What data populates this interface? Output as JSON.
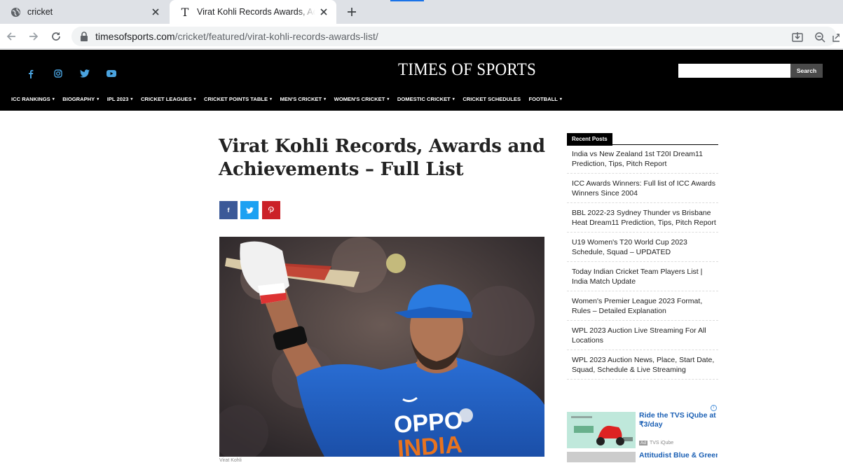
{
  "browser": {
    "tabs": [
      {
        "title": "cricket",
        "active": false
      },
      {
        "title": "Virat Kohli Records Awards, Achie",
        "active": true
      }
    ],
    "url_host": "timesofsports.com",
    "url_path": "/cricket/featured/virat-kohli-records-awards-list/",
    "icons": [
      "globe-icon",
      "close-icon",
      "new-tab-icon",
      "back-icon",
      "forward-icon",
      "reload-icon",
      "lock-icon",
      "install-icon",
      "zoom-icon",
      "share-icon"
    ]
  },
  "site": {
    "logo": "TIMES OF SPORTS",
    "social": [
      "facebook-icon",
      "instagram-icon",
      "twitter-icon",
      "youtube-icon"
    ],
    "search_label": "Search",
    "search_placeholder": "",
    "menu": [
      {
        "label": "ICC RANKINGS",
        "caret": true
      },
      {
        "label": "BIOGRAPHY",
        "caret": true
      },
      {
        "label": "IPL 2023",
        "caret": true
      },
      {
        "label": "CRICKET LEAGUES",
        "caret": true
      },
      {
        "label": "CRICKET POINTS TABLE",
        "caret": true
      },
      {
        "label": "MEN'S CRICKET",
        "caret": true
      },
      {
        "label": "WOMEN'S CRICKET",
        "caret": true
      },
      {
        "label": "DOMESTIC CRICKET",
        "caret": true
      },
      {
        "label": "CRICKET SCHEDULES",
        "caret": false
      },
      {
        "label": "FOOTBALL",
        "caret": true
      }
    ],
    "colors": {
      "header_bg": "#000000",
      "facebook": "#3b5998",
      "twitter": "#1da1f2",
      "pinterest": "#cb2027",
      "social_icon": "#4aa3df"
    }
  },
  "article": {
    "title_line1": "Virat Kohli Records, Awards and",
    "title_line2": "Achievements – Full List",
    "share_buttons": [
      {
        "name": "facebook-share",
        "glyph": "f"
      },
      {
        "name": "twitter-share",
        "glyph": "t"
      },
      {
        "name": "pinterest-share",
        "glyph": "p"
      }
    ],
    "hero_caption": "Virat Kohli"
  },
  "sidebar": {
    "heading": "Recent Posts",
    "posts": [
      {
        "line1": "India vs New Zealand 1st T20I Dream11",
        "line2": "Prediction, Tips, Pitch Report"
      },
      {
        "line1": "ICC Awards Winners: Full list of ICC Awards",
        "line2": "Winners Since 2004"
      },
      {
        "line1": "BBL 2022-23 Sydney Thunder vs Brisbane",
        "line2": "Heat Dream11 Prediction, Tips, Pitch Report"
      },
      {
        "line1": "U19 Women's T20 World Cup 2023",
        "line2": "Schedule, Squad – UPDATED"
      },
      {
        "line1": "Today Indian Cricket Team Players List |",
        "line2": "India Match Update"
      },
      {
        "line1": "Women's Premier League 2023 Format,",
        "line2": "Rules – Detailed Explanation"
      },
      {
        "line1": "WPL 2023 Auction Live Streaming For All",
        "line2": "Locations"
      },
      {
        "line1": "WPL 2023 Auction News, Place, Start Date,",
        "line2": "Squad, Schedule & Live Streaming"
      }
    ],
    "ad": {
      "title": "Ride the TVS iQube at ₹3/day",
      "badge": "Ad",
      "sponsor": "TVS iQube",
      "title2": "Attitudist Blue & Green"
    }
  }
}
